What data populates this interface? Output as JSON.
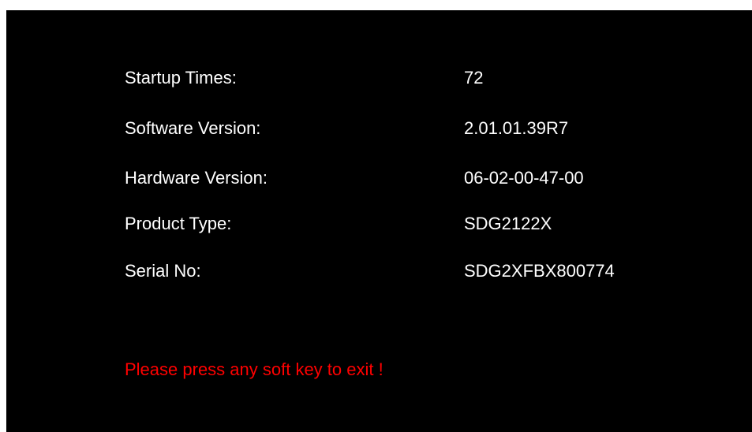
{
  "info": {
    "rows": [
      {
        "label": "Startup Times:",
        "value": "72"
      },
      {
        "label": "Software Version:",
        "value": "2.01.01.39R7"
      },
      {
        "label": "Hardware Version:",
        "value": "06-02-00-47-00"
      },
      {
        "label": "Product Type:",
        "value": "SDG2122X"
      },
      {
        "label": "Serial No:",
        "value": "SDG2XFBX800774"
      }
    ]
  },
  "exit_hint": {
    "text": "Please press any soft key to exit !",
    "color": "#ff0000"
  }
}
